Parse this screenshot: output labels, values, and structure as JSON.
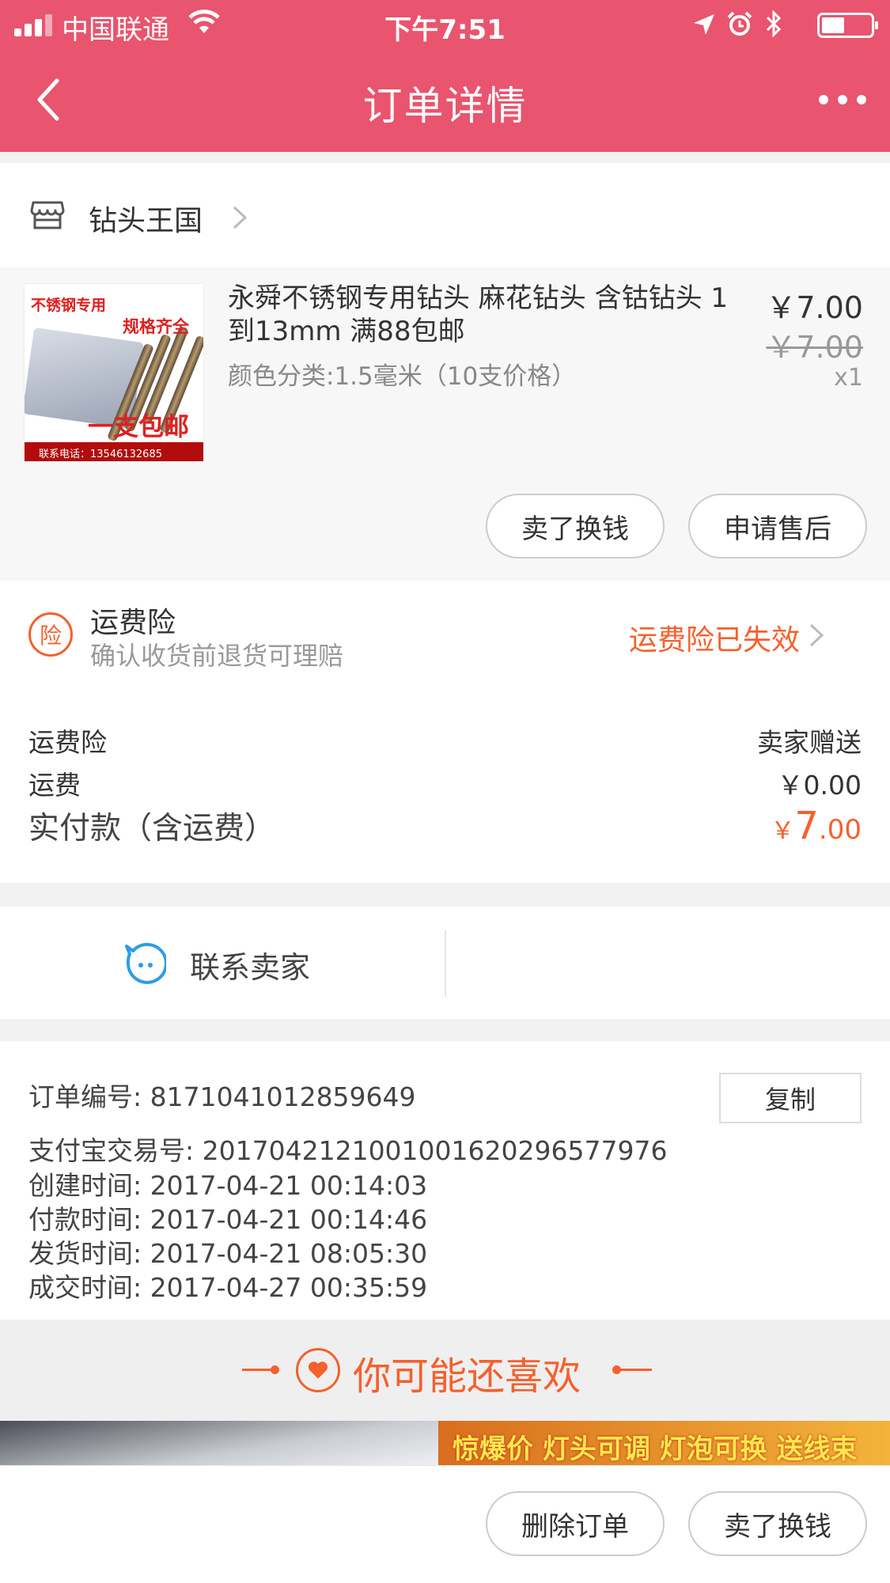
{
  "status_bar": {
    "carrier": "中国联通",
    "time": "下午7:51"
  },
  "nav": {
    "title": "订单详情",
    "back_icon": "chevron-left-icon",
    "more_icon": "more-dots-icon"
  },
  "shop": {
    "name": "钻头王国",
    "icon": "store-icon"
  },
  "product": {
    "image_texts": [
      "不锈钢专用",
      "规格齐全",
      "一支包邮",
      "联系电话：13546132685"
    ],
    "title": "永舜不锈钢专用钻头 麻花钻头 含钴钻头 1到13mm 满88包邮",
    "sku": "颜色分类:1.5毫米（10支价格）",
    "price": "￥7.00",
    "original_price": "￥7.00",
    "quantity": "x1",
    "buttons": [
      "卖了换钱",
      "申请售后"
    ]
  },
  "insurance": {
    "badge": "险",
    "title": "运费险",
    "subtitle": "确认收货前退货可理赔",
    "status": "运费险已失效"
  },
  "costs": [
    {
      "label": "运费险",
      "value": "卖家赠送"
    },
    {
      "label": "运费",
      "value": "￥0.00"
    }
  ],
  "total": {
    "label": "实付款（含运费）",
    "currency": "￥",
    "integer": "7",
    "decimal": ".00"
  },
  "contact": {
    "label": "联系卖家",
    "icon": "chat-bubble-icon"
  },
  "order_info": {
    "order_no": "订单编号:  8171041012859649",
    "alipay_no": "支付宝交易号:  2017042121001001620296577976",
    "created": "创建时间:  2017-04-21 00:14:03",
    "paid": "付款时间:  2017-04-21 00:14:46",
    "shipped": "发货时间:  2017-04-21 08:05:30",
    "completed": "成交时间:  2017-04-27 00:35:59",
    "copy_label": "复制"
  },
  "recommend": {
    "title": "你可能还喜欢",
    "banner_text": "惊爆价 灯头可调 灯泡可换 送线束"
  },
  "bottom_bar": {
    "buttons": [
      "删除订单",
      "卖了换钱"
    ]
  },
  "colors": {
    "brand": "#e9546e",
    "accent_orange": "#f5602d"
  }
}
